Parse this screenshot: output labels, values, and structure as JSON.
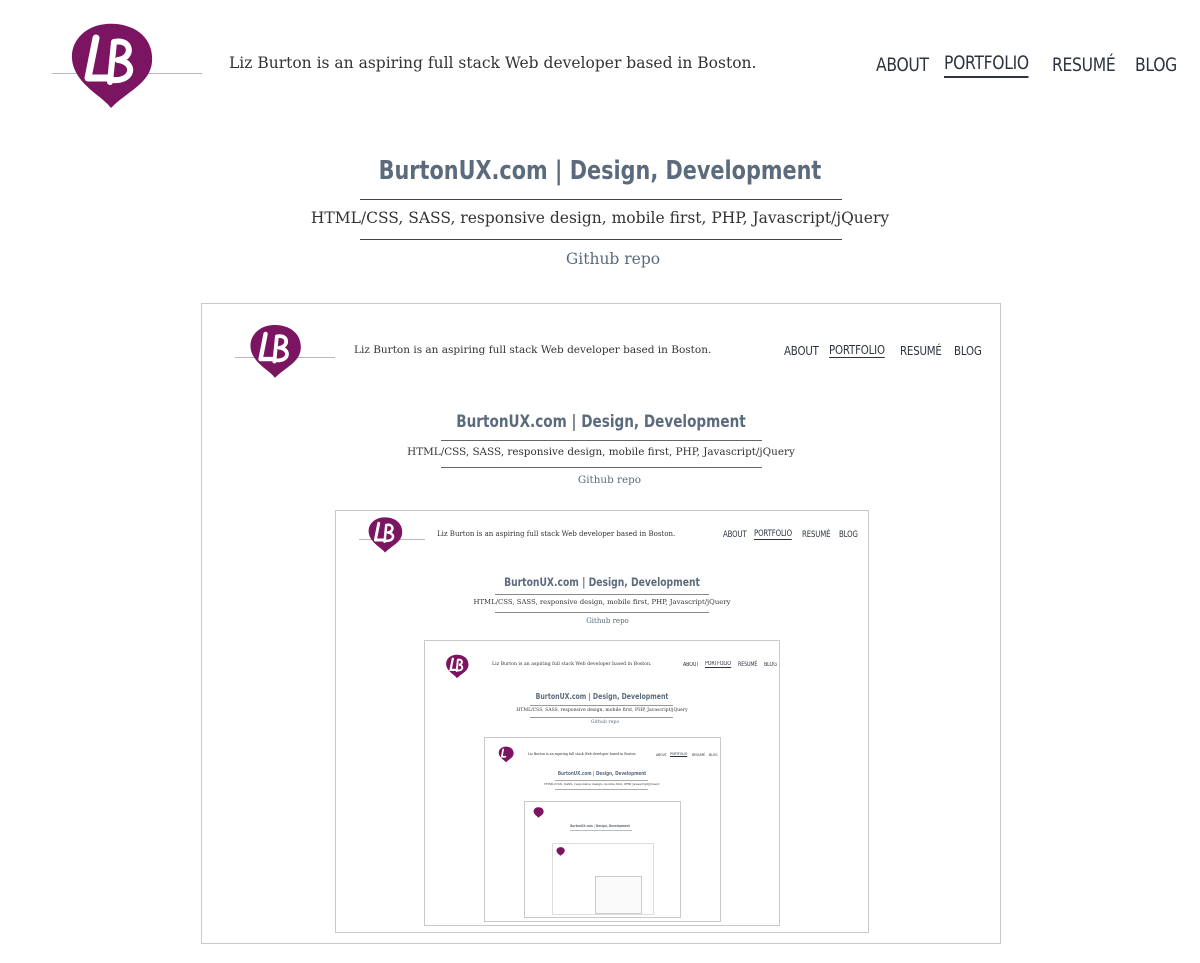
{
  "header": {
    "logo_text": "LB",
    "tagline": "Liz Burton is an aspiring full stack Web developer based in Boston."
  },
  "nav": {
    "items": [
      {
        "label": "ABOUT",
        "active": false
      },
      {
        "label": "PORTFOLIO",
        "active": true
      },
      {
        "label": "RESUMÉ",
        "active": false
      },
      {
        "label": "BLOG",
        "active": false
      }
    ]
  },
  "project": {
    "title": "BurtonUX.com | Design, Development",
    "tech": "HTML/CSS, SASS, responsive design, mobile first, PHP, Javascript/jQuery",
    "repo_link": "Github repo"
  },
  "colors": {
    "brand": "#7b1461",
    "title": "#5b6b7c",
    "nav": "#2d3340"
  }
}
